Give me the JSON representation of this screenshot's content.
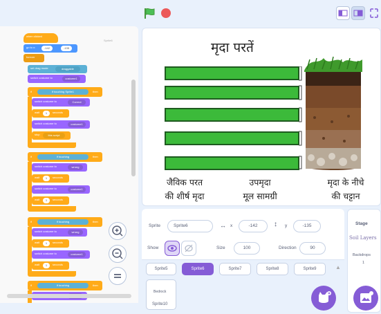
{
  "stage": {
    "title": "मृदा परतें",
    "labels": [
      {
        "line1": "जैविक परत",
        "line2": "की शीर्ष मृदा"
      },
      {
        "line1": "उपमृदा",
        "line2": "मूल सामग्री"
      },
      {
        "line1": "मृदा के नीचे",
        "line2": "की चट्टान"
      }
    ],
    "bar_color": "#3cba3a",
    "bar_border": "#1e5a1f"
  },
  "code": {
    "when_flag": "when clicked",
    "goto": "go to x:",
    "x": "-142",
    "y_label": "y:",
    "y": "-135",
    "forever": "forever",
    "drag": "set drag mode",
    "drag_val": "draggable",
    "switch1": "switch costume to",
    "costume1": "costume1",
    "if_touching": "if touching",
    "sprite1": "Sprite1",
    "then": "then",
    "switch_correct": "switch costume to",
    "correct": "Correct",
    "wait1": "wait",
    "wait_val": "1",
    "seconds": "seconds",
    "switch_c1": "switch costume to",
    "stop": "stop",
    "stop_val": "this script",
    "wrong": "wrong",
    "sprite_corner": "Sprite6"
  },
  "sprite_info": {
    "sprite_label": "Sprite",
    "sprite_name": "Sprite6",
    "x_label": "x",
    "x_value": "-142",
    "y_label": "y",
    "y_value": "-135",
    "show_label": "Show",
    "size_label": "Size",
    "size_value": "100",
    "direction_label": "Direction",
    "direction_value": "90"
  },
  "sprite_tiles": [
    "Sprite5",
    "Sprite6",
    "Sprite7",
    "Sprite8",
    "Sprite9"
  ],
  "bedrock_tile": {
    "name": "Bedrock",
    "label": "Sprite10"
  },
  "stage_panel": {
    "title": "Stage",
    "thumb": "Soil Layers",
    "backdrops_label": "Backdrops",
    "backdrops_count": "1"
  },
  "colors": {
    "accent": "#855cd6",
    "events": "#ffab19",
    "motion": "#4c97ff",
    "looks": "#9966ff",
    "sensing": "#5cb1d6"
  }
}
